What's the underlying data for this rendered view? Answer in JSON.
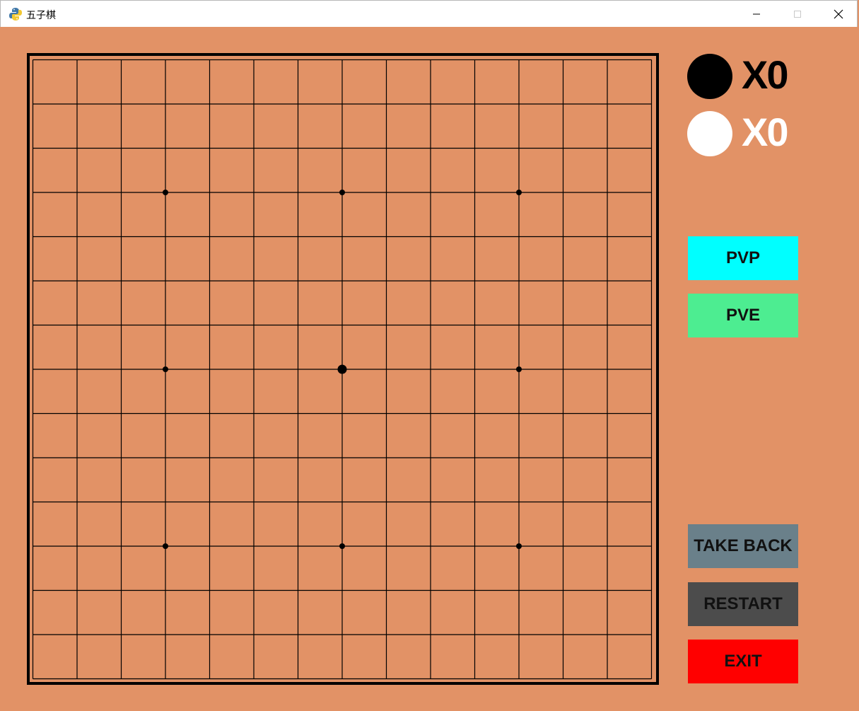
{
  "window": {
    "title": "五子棋",
    "app_icon": "python-icon",
    "controls": {
      "minimize": "minimize-icon",
      "maximize": "maximize-icon",
      "close": "close-icon"
    }
  },
  "board": {
    "background": "#e29266",
    "line_color": "#000000",
    "lines": 15,
    "star_points": [
      "D4",
      "H4",
      "L4",
      "D8",
      "H8",
      "L8",
      "D12",
      "H12",
      "L12"
    ],
    "center_point": "H8",
    "stones": []
  },
  "scoreboard": {
    "black": {
      "label": "X0",
      "stone_color": "#000000",
      "text_color": "#000000"
    },
    "white": {
      "label": "X0",
      "stone_color": "#ffffff",
      "text_color": "#ffffff"
    }
  },
  "buttons": {
    "pvp": {
      "label": "PVP",
      "color": "#00ffff"
    },
    "pve": {
      "label": "PVE",
      "color": "#4ded91"
    },
    "take_back": {
      "label": "TAKE BACK",
      "color": "#6a808a"
    },
    "restart": {
      "label": "RESTART",
      "color": "#4c4c4c"
    },
    "exit": {
      "label": "EXIT",
      "color": "#ff0000"
    }
  }
}
